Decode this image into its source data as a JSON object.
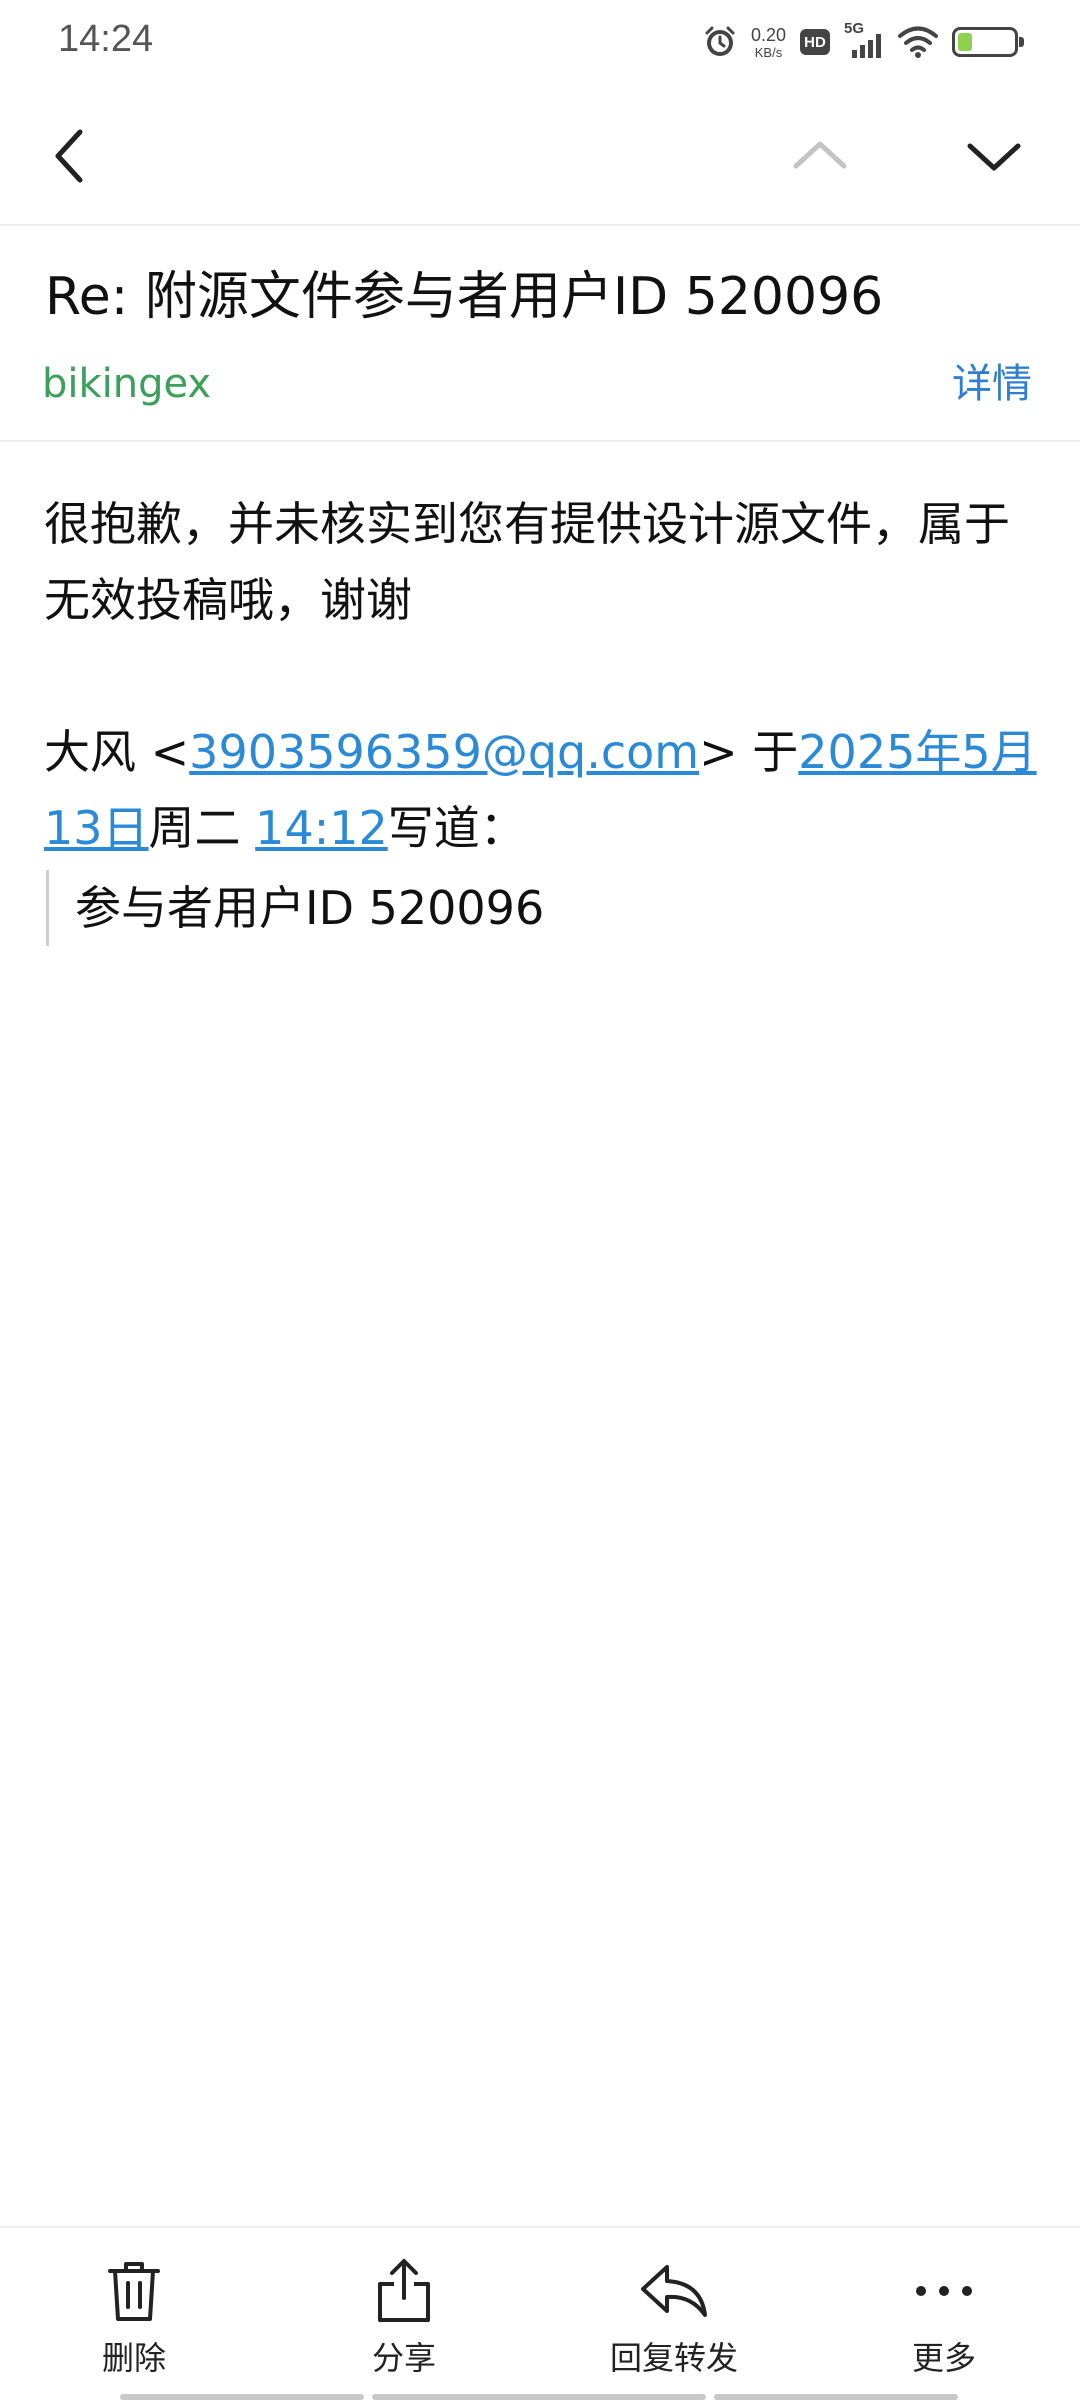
{
  "status_bar": {
    "time": "14:24",
    "net_speed_value": "0.20",
    "net_speed_unit": "KB/s",
    "hd_label": "HD",
    "network_label": "5G",
    "battery_level": 0.25,
    "icons": [
      "alarm-icon",
      "hd-icon",
      "signal-icon",
      "wifi-icon",
      "battery-icon"
    ]
  },
  "nav": {
    "icons": [
      "chevron-left-icon",
      "chevron-up-icon",
      "chevron-down-icon"
    ]
  },
  "email": {
    "subject": "Re: 附源文件参与者用户ID 520096",
    "sender": "bikingex",
    "details_label": "详情",
    "body_text": "很抱歉，并未核实到您有提供设计源文件，属于无效投稿哦，谢谢",
    "quote_header": {
      "name_prefix": "大风 <",
      "email": "3903596359@qq.com",
      "mid": "> 于",
      "date": "2025年5月13日",
      "weekday": "周二 ",
      "time": "14:12",
      "suffix": "写道："
    },
    "quoted_text": "参与者用户ID 520096"
  },
  "toolbar": {
    "delete_label": "删除",
    "share_label": "分享",
    "reply_label": "回复转发",
    "more_label": "更多"
  },
  "colors": {
    "sender": "#3aa05a",
    "link": "#2a8ad8",
    "details": "#2f7fd0",
    "battery_fill": "#8fd14f"
  }
}
